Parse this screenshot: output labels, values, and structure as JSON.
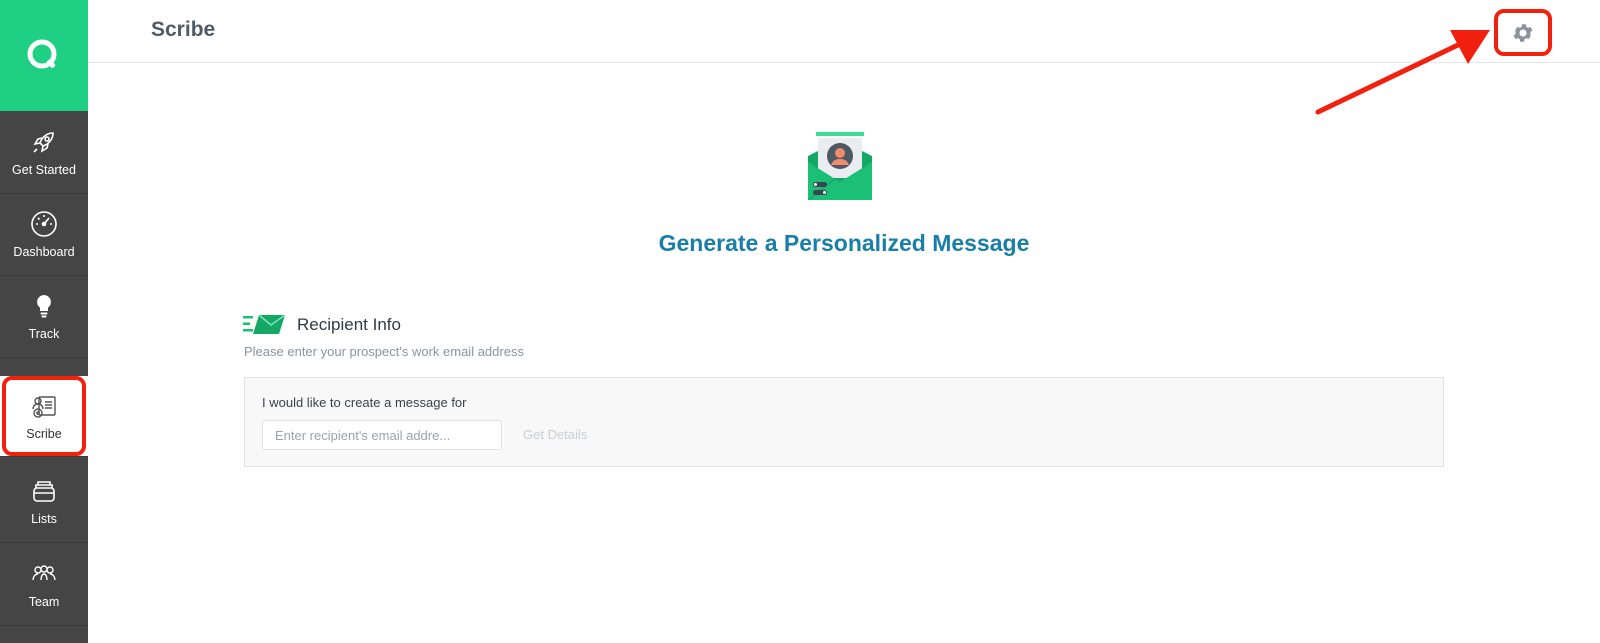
{
  "header": {
    "title": "Scribe"
  },
  "sidebar": {
    "items": [
      {
        "label": "Get Started",
        "icon": "rocket-icon"
      },
      {
        "label": "Dashboard",
        "icon": "speedometer-icon"
      },
      {
        "label": "Track",
        "icon": "lightbulb-icon"
      },
      {
        "label": "Scribe",
        "icon": "scribe-icon",
        "active": true
      },
      {
        "label": "Lists",
        "icon": "stack-icon"
      },
      {
        "label": "Team",
        "icon": "team-icon"
      }
    ]
  },
  "main": {
    "hero_title": "Generate a Personalized Message",
    "section_title": "Recipient Info",
    "section_subtitle": "Please enter your prospect's work email address",
    "form": {
      "label": "I would like to create a message for",
      "email_placeholder": "Enter recipient's email addre...",
      "get_details_label": "Get Details"
    }
  },
  "colors": {
    "brand_green": "#1fcf84",
    "sidebar_bg": "#454545",
    "title_blue": "#1a7fa8",
    "annotation_red": "#f2200f"
  }
}
